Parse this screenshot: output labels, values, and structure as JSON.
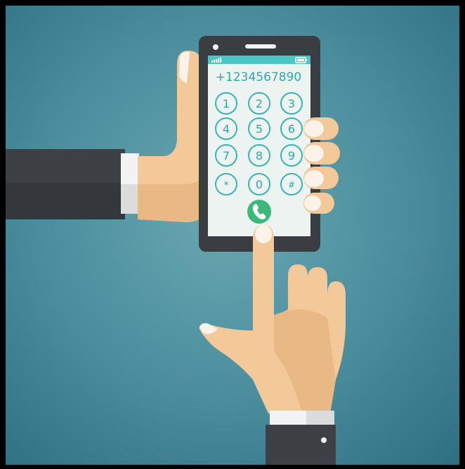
{
  "phone": {
    "number": "+1234567890",
    "keys": [
      "1",
      "2",
      "3",
      "4",
      "5",
      "6",
      "7",
      "8",
      "9",
      "*",
      "0",
      "#"
    ]
  },
  "colors": {
    "background": "#3f8494",
    "phone_body": "#3a3d42",
    "screen": "#edf3f1",
    "status_bar": "#4cc6c5",
    "key_outline": "#37b6b1",
    "call_button": "#3cb878",
    "skin": "#f4c99a",
    "sleeve": "#3d4145"
  },
  "icons": {
    "call": "phone-handset-icon",
    "signal": "signal-bars-icon",
    "battery": "battery-icon"
  }
}
